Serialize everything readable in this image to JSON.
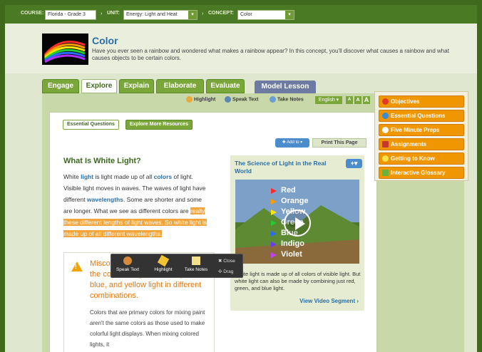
{
  "topbar": {
    "course_label": "COURSE:",
    "course_value": "Florida - Grade 3",
    "unit_label": "UNIT:",
    "unit_value": "Energy: Light and Heat",
    "concept_label": "CONCEPT:",
    "concept_value": "Color",
    "separator": "›"
  },
  "header": {
    "title": "Color",
    "intro": "Have you ever seen a rainbow and wondered what makes a rainbow appear? In this concept, you'll discover what causes a rainbow and what causes objects to be certain colors."
  },
  "tabs": [
    "Engage",
    "Explore",
    "Explain",
    "Elaborate",
    "Evaluate"
  ],
  "active_tab": "Explore",
  "model_lesson": "Model Lesson",
  "toolbar": {
    "highlight": "Highlight",
    "speak": "Speak Text",
    "notes": "Take Notes",
    "language": "English ▾",
    "font_sizes": [
      "A",
      "A",
      "A"
    ]
  },
  "subtabs": {
    "essential": "Essential Questions",
    "more": "Explore More Resources"
  },
  "actions": {
    "add_to": "✚ Add to ▾",
    "print": "Print This Page"
  },
  "white_light": {
    "title": "What Is White Light?",
    "p1_a": "White ",
    "kw_light": "light",
    "p1_b": " is light made up of all ",
    "kw_colors": "colors",
    "p1_c": " of light. Visible light moves in waves. The waves of light have different ",
    "kw_wavelengths": "wavelengths",
    "p1_d": ". Some are shorter and some are longer. What we see as different colors are ",
    "highlighted": "really these different lengths of light waves. So white light is made up of all different wavelengths."
  },
  "misconception": {
    "title": "Misconception: Many people think the colors of light are red, yellow, blue, and yellow light in different combinations.",
    "warn_mark": "!",
    "body": "Colors that are primary colors for mixing paint aren't the same colors as those used to make colorful light displays. When mixing colored lights, it"
  },
  "science": {
    "title": "The Science of Light in the Real World",
    "plus": "+▾",
    "video_labels": [
      "Red",
      "Orange",
      "Yellow",
      "Green",
      "Blue",
      "Indigo",
      "Violet"
    ],
    "caption": "White light is made up of all colors of visible light. But white light can also be made by combining just red, green, and blue light.",
    "view_link": "View Video Segment ›"
  },
  "popup": {
    "speak": "Speak Text",
    "highlight": "Highlight",
    "notes": "Take Notes",
    "close": "✖ Close",
    "drag": "✣ Drag"
  },
  "sidebar": [
    "Objectives",
    "Essential Questions",
    "Five Minute Preps",
    "Assignments",
    "Getting to Know",
    "Interactive Glossary"
  ],
  "colors": {
    "brand_green": "#4a7a23",
    "accent_orange": "#f09600",
    "link_blue": "#2b6fa6"
  }
}
